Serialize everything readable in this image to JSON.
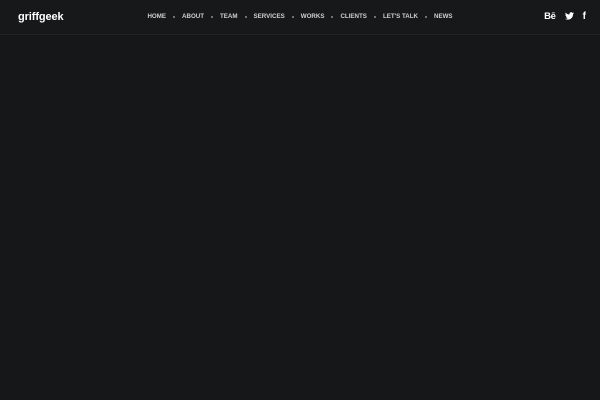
{
  "header": {
    "logo": "griffgeek",
    "nav": [
      {
        "label": "HOME"
      },
      {
        "label": "ABOUT"
      },
      {
        "label": "TEAM"
      },
      {
        "label": "SERVICES"
      },
      {
        "label": "WORKS"
      },
      {
        "label": "CLIENTS"
      },
      {
        "label": "LET'S TALK"
      },
      {
        "label": "NEWS"
      }
    ],
    "social": [
      {
        "icon": "behance-icon",
        "glyph": "Bē"
      },
      {
        "icon": "twitter-icon"
      },
      {
        "icon": "facebook-icon",
        "glyph": "f"
      }
    ]
  },
  "theme": {
    "background": "#161719",
    "header_background": "#17181a",
    "text": "#ffffff",
    "nav_text": "#cfcfcf"
  }
}
